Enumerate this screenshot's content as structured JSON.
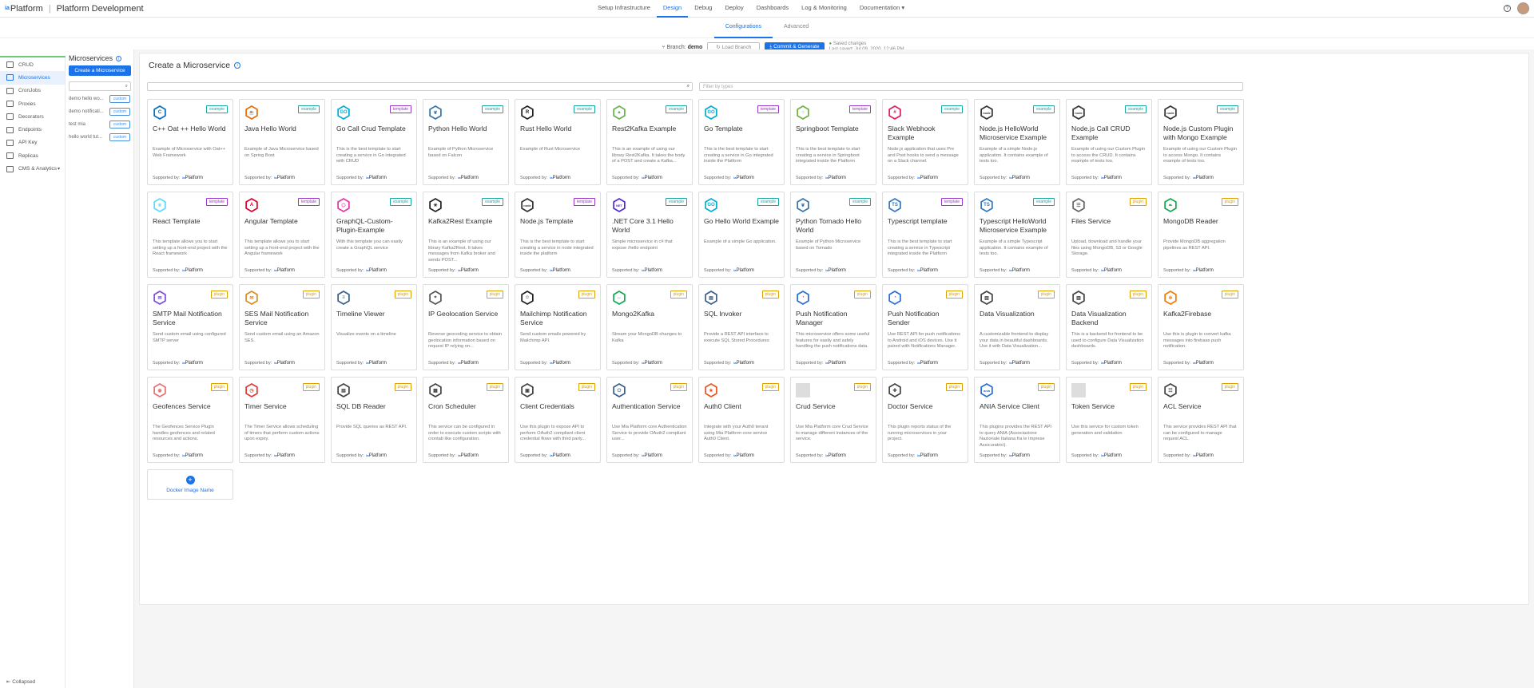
{
  "header": {
    "logo_mark": "ia",
    "brand": "Platform",
    "title": "Platform Development",
    "tabs": [
      {
        "label": "Setup Infrastructure",
        "active": false
      },
      {
        "label": "Design",
        "active": true
      },
      {
        "label": "Debug",
        "active": false
      },
      {
        "label": "Deploy",
        "active": false
      },
      {
        "label": "Dashboards",
        "active": false
      },
      {
        "label": "Log & Monitoring",
        "active": false
      },
      {
        "label": "Documentation ▾",
        "active": false
      }
    ]
  },
  "subnav": {
    "configurations": "Configurations",
    "advanced": "Advanced"
  },
  "branchbar": {
    "branch_label": "Branch:",
    "branch_name": "demo",
    "load_branch": "Load Branch",
    "commit": "Commit & Generate",
    "saved_status": "Saved changes",
    "last_saved": "Last saved: Jul 09, 2020, 12:46 PM"
  },
  "leftnav": {
    "items": [
      {
        "label": "CRUD",
        "icon": "folder-icon"
      },
      {
        "label": "Microservices",
        "icon": "microservice-icon",
        "active": true
      },
      {
        "label": "CronJobs",
        "icon": "clock-icon"
      },
      {
        "label": "Proxies",
        "icon": "proxy-icon"
      },
      {
        "label": "Decorators",
        "icon": "decorator-icon"
      },
      {
        "label": "Endpoints",
        "icon": "endpoint-icon"
      },
      {
        "label": "API Key",
        "icon": "key-icon"
      },
      {
        "label": "Replicas",
        "icon": "replica-icon"
      },
      {
        "label": "CMS & Analytics",
        "icon": "cms-icon"
      }
    ],
    "collapse": "Collapsed"
  },
  "svcpanel": {
    "title": "Microservices",
    "create_button": "Create a Microservice",
    "services": [
      {
        "name": "demo hello wo...",
        "badge": "custom"
      },
      {
        "name": "demo notificati...",
        "badge": "custom"
      },
      {
        "name": "test mia",
        "badge": "custom"
      },
      {
        "name": "hello world tut...",
        "badge": "custom"
      }
    ]
  },
  "main": {
    "title": "Create a Microservice",
    "filter_placeholder": "Filter by types",
    "supported_by": "Supported by:",
    "docker_label": "Docker Image Name",
    "cards": [
      {
        "name": "C++ Oat ++ Hello World",
        "tag": "example",
        "desc": "Example of Microservice with Oat++ Web Framework",
        "icon": "cpp-icon",
        "color": "#0a6ebd",
        "glyph": "C"
      },
      {
        "name": "Java Hello World",
        "tag": "example",
        "desc": "Example of Java Microservice based on Spring Boot",
        "icon": "java-icon",
        "color": "#e76f00",
        "glyph": "☕"
      },
      {
        "name": "Go Call Crud Template",
        "tag": "template",
        "desc": "This is the best template to start creating a service in Go integrated with CRUD",
        "icon": "go-icon",
        "color": "#00add8",
        "glyph": "GO"
      },
      {
        "name": "Python Hello World",
        "tag": "example",
        "desc": "Example of Python Microservice based on Falcon",
        "icon": "python-icon",
        "color": "#3776ab",
        "glyph": "❦"
      },
      {
        "name": "Rust Hello World",
        "tag": "example",
        "desc": "Example of Rust Microservice",
        "icon": "rust-icon",
        "color": "#222222",
        "glyph": "R"
      },
      {
        "name": "Rest2Kafka Example",
        "tag": "example",
        "desc": "This is an example of using our library Rest2Kafka. It takes the body of a POST and create a Kafka...",
        "icon": "rest2kafka-icon",
        "color": "#6ab04c",
        "glyph": "▲"
      },
      {
        "name": "Go Template",
        "tag": "template",
        "desc": "This is the best template to start creating a service in Go integrated inside the Platform",
        "icon": "go-icon",
        "color": "#00add8",
        "glyph": "GO"
      },
      {
        "name": "Springboot Template",
        "tag": "template",
        "desc": "This is the best template to start creating a service in Springboot integrated inside the Platform",
        "icon": "spring-icon",
        "color": "#6db33f",
        "glyph": "○"
      },
      {
        "name": "Slack Webhook Example",
        "tag": "example",
        "desc": "Node.js application that uses Pre and Post hooks to send a message on a Slack channel.",
        "icon": "slack-icon",
        "color": "#e01e5a",
        "glyph": "#"
      },
      {
        "name": "Node.js HelloWorld Microservice Example",
        "tag": "example",
        "desc": "Example of a simple Node.js application. It contains example of tests too.",
        "icon": "nodejs-icon",
        "color": "#333333",
        "glyph": "node"
      },
      {
        "name": "Node.js Call CRUD Example",
        "tag": "example",
        "desc": "Example of using our Custom Plugin to access the CRUD. It contains example of tests too.",
        "icon": "nodejs-icon",
        "color": "#333333",
        "glyph": "node"
      },
      {
        "name": "Node.js Custom Plugin with Mongo Example",
        "tag": "example",
        "desc": "Example of using our Custom Plugin to access Mongo. It contains example of tests too.",
        "icon": "nodejs-icon",
        "color": "#333333",
        "glyph": "node"
      },
      {
        "name": "React Template",
        "tag": "template",
        "desc": "This template allows you to start setting up a front-end project with the React framework",
        "icon": "react-icon",
        "color": "#61dafb",
        "glyph": "⚛"
      },
      {
        "name": "Angular Template",
        "tag": "template",
        "desc": "This template allows you to start setting up a front-end project with the Angular framework",
        "icon": "angular-icon",
        "color": "#dd0031",
        "glyph": "A"
      },
      {
        "name": "GraphQL-Custom-Plugin-Example",
        "tag": "example",
        "desc": "With this template you can easily create a GraphQL service",
        "icon": "graphql-icon",
        "color": "#e535ab",
        "glyph": "⬡"
      },
      {
        "name": "Kafka2Rest Example",
        "tag": "example",
        "desc": "This is an example of using our library Kafka2Rest. It takes messages from Kafka broker and sends POST...",
        "icon": "kafka-icon",
        "color": "#222222",
        "glyph": "✳"
      },
      {
        "name": "Node.js Template",
        "tag": "template",
        "desc": "This is the best template to start creating a service in node integrated inside the platform",
        "icon": "nodejs-icon",
        "color": "#333333",
        "glyph": "node"
      },
      {
        "name": ".NET Core 3.1 Hello World",
        "tag": "example",
        "desc": "Simple microservice in c# that expose /hello endpoint",
        "icon": "dotnet-icon",
        "color": "#512bd4",
        "glyph": "NET"
      },
      {
        "name": "Go Hello World Example",
        "tag": "example",
        "desc": "Example of a simple Go application.",
        "icon": "go-icon",
        "color": "#00add8",
        "glyph": "GO"
      },
      {
        "name": "Python Tornado Hello World",
        "tag": "example",
        "desc": "Example of Python Microservice based on Tornado",
        "icon": "python-icon",
        "color": "#3776ab",
        "glyph": "❦"
      },
      {
        "name": "Typescript template",
        "tag": "template",
        "desc": "This is the best template to start creating a service in Typescript integrated inside the Platform",
        "icon": "typescript-icon",
        "color": "#3178c6",
        "glyph": "TS"
      },
      {
        "name": "Typescript HelloWorld Microservice Example",
        "tag": "example",
        "desc": "Example of a simple Typescript application. It contains example of tests too.",
        "icon": "typescript-icon",
        "color": "#3178c6",
        "glyph": "TS"
      },
      {
        "name": "Files Service",
        "tag": "plugin",
        "desc": "Upload, download and handle your files using MongoDB, S3 or Google Storage.",
        "icon": "files-icon",
        "color": "#666666",
        "glyph": "☰"
      },
      {
        "name": "MongoDB Reader",
        "tag": "plugin",
        "desc": "Provide MongoDB aggregation pipelines as REST API.",
        "icon": "mongodb-icon",
        "color": "#13aa52",
        "glyph": "❧"
      },
      {
        "name": "SMTP Mail Notification Service",
        "tag": "plugin",
        "desc": "Send custom email using configured SMTP server",
        "icon": "mail-icon",
        "color": "#7b4ed9",
        "glyph": "✉"
      },
      {
        "name": "SES Mail Notification Service",
        "tag": "plugin",
        "desc": "Send custom email using an Amazon SES.",
        "icon": "ses-icon",
        "color": "#d98e1f",
        "glyph": "✉"
      },
      {
        "name": "Timeline Viewer",
        "tag": "plugin",
        "desc": "Visualize events on a timeline",
        "icon": "timeline-icon",
        "color": "#3a5f8a",
        "glyph": "≡"
      },
      {
        "name": "IP Geolocation Service",
        "tag": "plugin",
        "desc": "Reverse geocoding service to obtain geolocation information based on request IP relying on...",
        "icon": "geolocation-icon",
        "color": "#555555",
        "glyph": "⌖"
      },
      {
        "name": "Mailchimp Notification Service",
        "tag": "plugin",
        "desc": "Send custom emails powered by Mailchimp API.",
        "icon": "mailchimp-icon",
        "color": "#222222",
        "glyph": "☺"
      },
      {
        "name": "Mongo2Kafka",
        "tag": "plugin",
        "desc": "Stream your MongoDB changes to Kafka",
        "icon": "mongo2kafka-icon",
        "color": "#13aa52",
        "glyph": "↔"
      },
      {
        "name": "SQL Invoker",
        "tag": "plugin",
        "desc": "Provide a REST API interface to execute SQL Stored Procedures",
        "icon": "sql-icon",
        "color": "#3a5f8a",
        "glyph": "▤"
      },
      {
        "name": "Push Notification Manager",
        "tag": "plugin",
        "desc": "This microservice offers some useful features for easily and safely handling the push notifications data.",
        "icon": "push-notification-icon",
        "color": "#2b6fd6",
        "glyph": "◔"
      },
      {
        "name": "Push Notification Sender",
        "tag": "plugin",
        "desc": "Use REST API for push notifications to Android and iOS devices. Use it paired with Notifications Manager.",
        "icon": "push-sender-icon",
        "color": "#2b6fd6",
        "glyph": "◔"
      },
      {
        "name": "Data Visualization",
        "tag": "plugin",
        "desc": "A customizable frontend to display your data in beautiful dashboards. Use it with Data Visualization...",
        "icon": "data-visualization-icon",
        "color": "#444444",
        "glyph": "▥"
      },
      {
        "name": "Data Visualization Backend",
        "tag": "plugin",
        "desc": "This is a backend for frontend to be used to configure Data Visualization dashboards.",
        "icon": "data-visualization-backend-icon",
        "color": "#444444",
        "glyph": "▥"
      },
      {
        "name": "Kafka2Firebase",
        "tag": "plugin",
        "desc": "Use this is plugin to convert kafka messages into firebase push notification.",
        "icon": "firebase-icon",
        "color": "#f57c00",
        "glyph": "✲"
      },
      {
        "name": "Geofences Service",
        "tag": "plugin",
        "desc": "The Geofences Service Plugin handles geofences and related resources and actions.",
        "icon": "geofence-icon",
        "color": "#e57373",
        "glyph": "◉"
      },
      {
        "name": "Timer Service",
        "tag": "plugin",
        "desc": "The Timer Service allows scheduling of timers that perform custom actions upon expiry.",
        "icon": "timer-icon",
        "color": "#e53935",
        "glyph": "◷"
      },
      {
        "name": "SQL DB Reader",
        "tag": "plugin",
        "desc": "Provide SQL queries as REST API.",
        "icon": "sql-reader-icon",
        "color": "#444444",
        "glyph": "▤"
      },
      {
        "name": "Cron Scheduler",
        "tag": "plugin",
        "desc": "This service can be configured in order to execute custom scripts with crontab like configuration.",
        "icon": "cron-icon",
        "color": "#444444",
        "glyph": "▦"
      },
      {
        "name": "Client Credentials",
        "tag": "plugin",
        "desc": "Use this plugin to expose API to perform OAuth2 compliant client credential flows with third party...",
        "icon": "credentials-icon",
        "color": "#444444",
        "glyph": "▣"
      },
      {
        "name": "Authentication Service",
        "tag": "plugin",
        "desc": "Use Mia Platform core Authentication Service to provide OAuth2 compliant user...",
        "icon": "authentication-icon",
        "color": "#3a5f8a",
        "glyph": "⚇"
      },
      {
        "name": "Auth0 Client",
        "tag": "plugin",
        "desc": "Integrate with your Auth0 tenant using Mia Platform core service Auth0 Client.",
        "icon": "auth0-icon",
        "color": "#eb5424",
        "glyph": "★"
      },
      {
        "name": "Crud Service",
        "tag": "plugin",
        "desc": "Use Mia Platform core Crud Service to manage different instances of the service.",
        "icon": "crud-icon",
        "color": "#dddddd",
        "glyph": ""
      },
      {
        "name": "Doctor Service",
        "tag": "plugin",
        "desc": "This plugin reports status of the running microservices in your project.",
        "icon": "doctor-icon",
        "color": "#444444",
        "glyph": "✚"
      },
      {
        "name": "ANIA Service Client",
        "tag": "plugin",
        "desc": "This plugins provides the REST API to query ANIA (Associazione Nazionale Italiana fra le Imprese Assicuratrici).",
        "icon": "ania-icon",
        "color": "#2b6fd6",
        "glyph": "ania"
      },
      {
        "name": "Token Service",
        "tag": "plugin",
        "desc": "Use this service for custom token generation and validation",
        "icon": "token-icon",
        "color": "#dddddd",
        "glyph": ""
      },
      {
        "name": "ACL Service",
        "tag": "plugin",
        "desc": "This service provides REST API that can be configured to manage request ACL.",
        "icon": "acl-icon",
        "color": "#444444",
        "glyph": "☷"
      }
    ]
  }
}
